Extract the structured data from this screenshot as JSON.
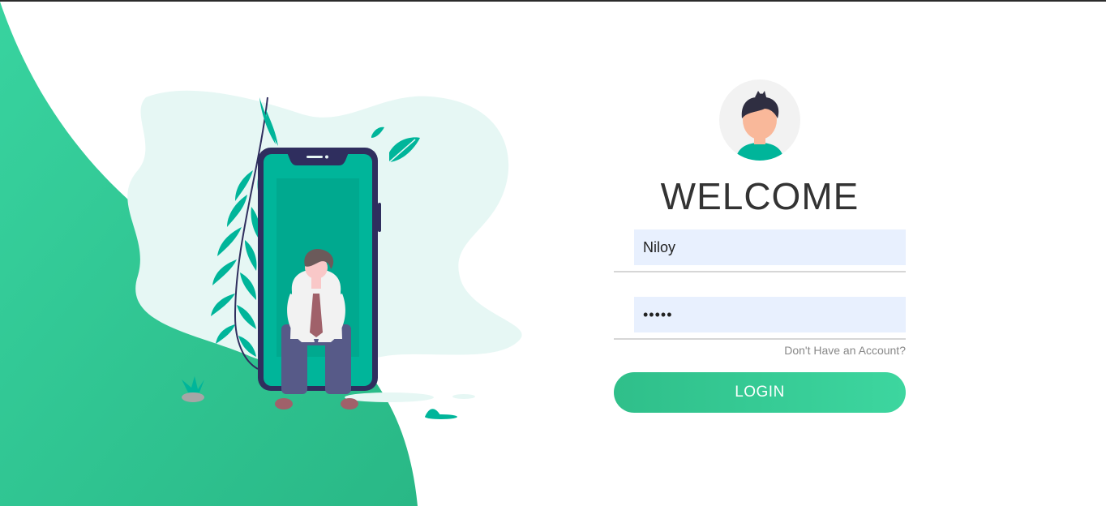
{
  "colors": {
    "accent": "#32be8f",
    "accent_light": "#38d39f",
    "blob": "#e6f7f4",
    "phone_frame": "#2f2e5e",
    "phone_screen": "#00b59a",
    "input_fill": "#e8f0fe",
    "heading": "#333333"
  },
  "icons": {
    "avatar": "user-avatar-icon"
  },
  "login": {
    "heading": "WELCOME",
    "username": {
      "value": "Niloy",
      "type": "text"
    },
    "password": {
      "value": "•••••",
      "type": "password"
    },
    "signup_link": "Don't Have an Account?",
    "submit_label": "LOGIN"
  }
}
